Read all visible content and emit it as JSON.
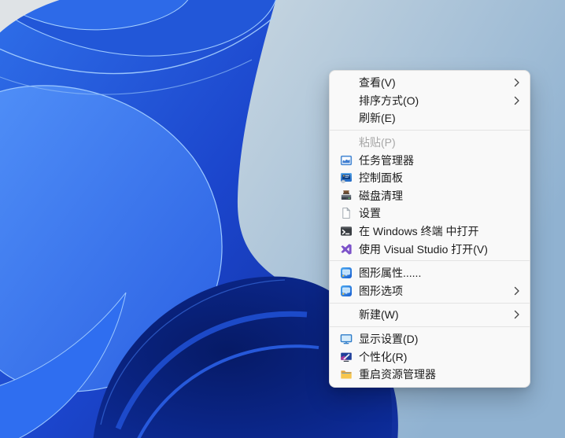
{
  "wallpaper": {
    "name": "windows-11-bloom",
    "sky_left": "#e3e6e9",
    "sky_right": "#90b2d1",
    "bloom_bright": "#4f8ef7",
    "bloom_mid": "#2a63e4",
    "bloom_deep": "#1638c0",
    "bloom_navy": "#081d6b",
    "highlight": "#a8d2ff"
  },
  "menu": {
    "background": "#f9f9f9",
    "text_color": "#1c1c1c",
    "disabled_color": "#a7a7a7",
    "separator_color": "#e3e3e3",
    "chevron_color": "#454545",
    "items": [
      {
        "label": "查看(V)",
        "icon": "none",
        "submenu": true,
        "disabled": false
      },
      {
        "label": "排序方式(O)",
        "icon": "none",
        "submenu": true,
        "disabled": false
      },
      {
        "label": "刷新(E)",
        "icon": "none",
        "submenu": false,
        "disabled": false
      },
      {
        "label": "粘贴(P)",
        "icon": "none",
        "submenu": false,
        "disabled": true
      },
      {
        "label": "任务管理器",
        "icon": "task-manager-icon",
        "submenu": false,
        "disabled": false
      },
      {
        "label": "控制面板",
        "icon": "control-panel-icon",
        "submenu": false,
        "disabled": false
      },
      {
        "label": "磁盘清理",
        "icon": "disk-cleanup-icon",
        "submenu": false,
        "disabled": false
      },
      {
        "label": "设置",
        "icon": "document-icon",
        "submenu": false,
        "disabled": false
      },
      {
        "label": "在 Windows 终端 中打开",
        "icon": "windows-terminal-icon",
        "submenu": false,
        "disabled": false
      },
      {
        "label": "使用 Visual Studio 打开(V)",
        "icon": "visual-studio-icon",
        "submenu": false,
        "disabled": false
      },
      {
        "label": "图形属性......",
        "icon": "intel-graphics-icon",
        "submenu": false,
        "disabled": false
      },
      {
        "label": "图形选项",
        "icon": "intel-graphics-icon",
        "submenu": true,
        "disabled": false
      },
      {
        "label": "新建(W)",
        "icon": "none",
        "submenu": true,
        "disabled": false
      },
      {
        "label": "显示设置(D)",
        "icon": "display-settings-icon",
        "submenu": false,
        "disabled": false
      },
      {
        "label": "个性化(R)",
        "icon": "personalization-icon",
        "submenu": false,
        "disabled": false
      },
      {
        "label": "重启资源管理器",
        "icon": "folder-icon",
        "submenu": false,
        "disabled": false
      }
    ]
  }
}
